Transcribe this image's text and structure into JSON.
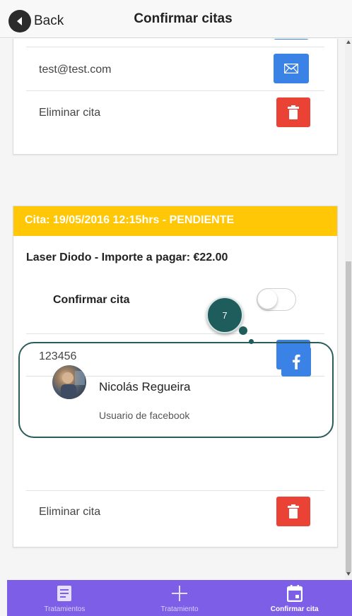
{
  "header": {
    "back_label": "Back",
    "title": "Confirmar citas"
  },
  "card1": {
    "email": "test@test.com",
    "delete_label": "Eliminar cita"
  },
  "card2": {
    "header": "Cita: 19/05/2016 12:15hrs - PENDIENTE",
    "treatment": "Laser Diodo - Importe a pagar: €22.00",
    "confirm_label": "Confirmar cita",
    "confirm_checked": false,
    "phone": "123456",
    "user_name": "Nicolás Regueira",
    "user_subtitle": "Usuario de facebook",
    "delete_label": "Eliminar cita"
  },
  "annotation": {
    "badge_number": "7"
  },
  "bottom_nav": {
    "items": [
      {
        "label": "Tratamientos",
        "icon": "list-icon"
      },
      {
        "label": "Tratamiento",
        "icon": "plus-icon"
      },
      {
        "label": "Confirmar cita",
        "icon": "calendar-icon"
      }
    ],
    "active_index": 2
  },
  "colors": {
    "accent_yellow": "#ffc705",
    "button_blue": "#3b82e7",
    "button_red": "#ea4335",
    "nav_purple": "#7c5fe6",
    "highlight_teal": "#1f5c5c"
  }
}
